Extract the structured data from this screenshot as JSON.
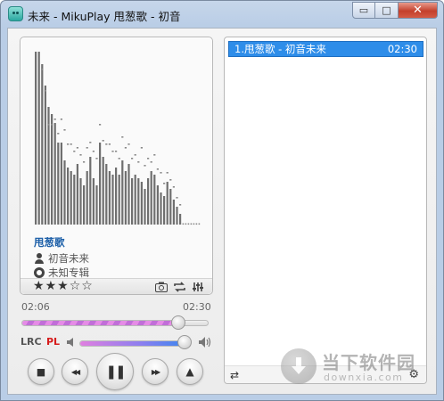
{
  "window": {
    "title": "未来 - MikuPlay  甩葱歌 - 初音",
    "controls": {
      "minimize": "▭",
      "maximize": "□",
      "close": "✕"
    }
  },
  "now_playing": {
    "title": "甩葱歌",
    "artist": "初音未来",
    "album": "未知专辑",
    "rating": 3,
    "rating_max": 5,
    "star_full": "★",
    "star_empty": "☆"
  },
  "visualizer": {
    "bars": [
      0.97,
      0.97,
      0.9,
      0.78,
      0.66,
      0.62,
      0.57,
      0.46,
      0.46,
      0.36,
      0.32,
      0.3,
      0.28,
      0.34,
      0.26,
      0.22,
      0.3,
      0.38,
      0.26,
      0.22,
      0.46,
      0.38,
      0.34,
      0.3,
      0.28,
      0.32,
      0.28,
      0.36,
      0.3,
      0.34,
      0.26,
      0.28,
      0.26,
      0.24,
      0.2,
      0.26,
      0.3,
      0.28,
      0.22,
      0.18,
      0.16,
      0.24,
      0.2,
      0.14,
      0.1,
      0.06
    ],
    "peaks": [
      0,
      0,
      0.86,
      0.74,
      0.55,
      0.55,
      0.58,
      0.5,
      0.58,
      0.52,
      0.44,
      0.44,
      0.4,
      0.42,
      0.38,
      0.34,
      0.42,
      0.45,
      0.4,
      0.36,
      0.55,
      0.46,
      0.44,
      0.44,
      0.4,
      0.4,
      0.36,
      0.48,
      0.42,
      0.44,
      0.36,
      0.38,
      0.34,
      0.42,
      0.32,
      0.36,
      0.34,
      0.38,
      0.3,
      0.28,
      0.22,
      0.28,
      0.24,
      0.2,
      0.14,
      0.1
    ],
    "bar_color": "#6f6f6f"
  },
  "card_icons": [
    "camera-icon",
    "repeat-icon",
    "equalizer-icon"
  ],
  "progress": {
    "current": "02:06",
    "total": "02:30",
    "value": 0.84
  },
  "volume": {
    "value": 0.94
  },
  "toggles": {
    "lrc": "LRC",
    "pl": "PL"
  },
  "transport": {
    "stop": "■",
    "prev": "◀◀",
    "pause": "❚❚",
    "next": "▶▶",
    "eject": "▲"
  },
  "playlist": {
    "items": [
      {
        "label": "1.甩葱歌 - 初音未来",
        "duration": "02:30",
        "selected": true
      }
    ],
    "footer": {
      "swap": "⇄",
      "gear": "⚙"
    }
  },
  "watermark": {
    "text": "当下软件园",
    "sub": "downxia.com"
  },
  "colors": {
    "accent": "#2e8de9",
    "song_title": "#1c5fa8",
    "pl_red": "#d61b1b"
  }
}
